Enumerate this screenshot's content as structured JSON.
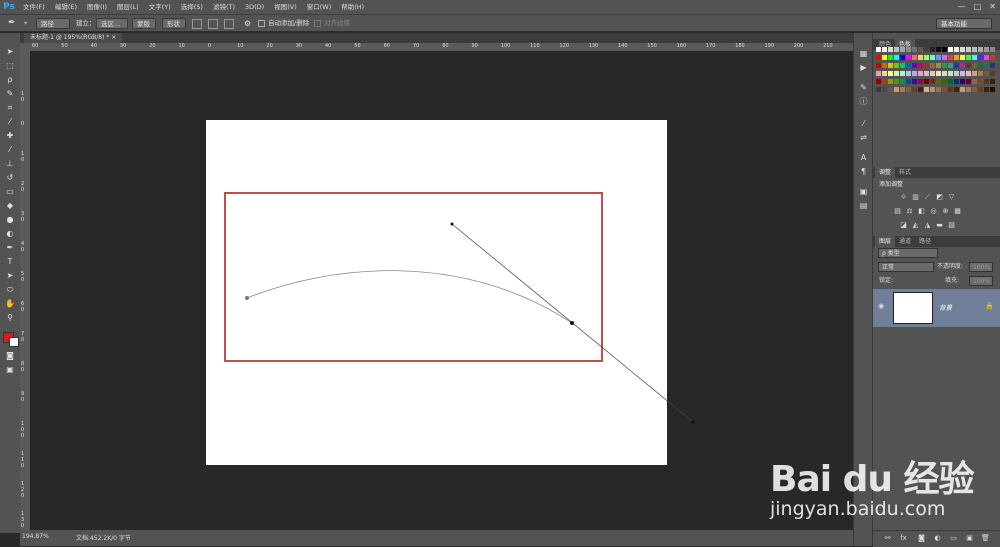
{
  "app": {
    "logo": "Ps"
  },
  "menubar": {
    "items": [
      "文件(F)",
      "编辑(E)",
      "图像(I)",
      "图层(L)",
      "文字(Y)",
      "选择(S)",
      "滤镜(T)",
      "3D(D)",
      "视图(V)",
      "窗口(W)",
      "帮助(H)"
    ]
  },
  "window_controls": {
    "minimize": "—",
    "maximize": "□",
    "close": "✕"
  },
  "options": {
    "tool_mode": "路径",
    "make_label": "建立：",
    "selection_button": "选区...",
    "mask_button": "蒙版",
    "shape_button": "形状",
    "auto_add_delete": "自动添加/删除",
    "align_edges": "对齐边缘",
    "workspace": "基本功能"
  },
  "document": {
    "tab_title": "未标题-1 @ 195%(RGB/8) *",
    "tab_close": "×",
    "zoom": "194.87%",
    "info": "文档:452.2K/0 字节"
  },
  "rulers": {
    "h_labels": [
      "60",
      "50",
      "40",
      "30",
      "20",
      "10",
      "0",
      "10",
      "20",
      "30",
      "40",
      "50",
      "60",
      "70",
      "80",
      "90",
      "100",
      "110",
      "120",
      "130",
      "140",
      "150",
      "160",
      "170",
      "180",
      "190",
      "200",
      "210"
    ],
    "v_labels": [
      "10",
      "0",
      "10",
      "20",
      "30",
      "40",
      "50",
      "60",
      "70",
      "80",
      "90",
      "100",
      "110",
      "120",
      "130"
    ]
  },
  "panels": {
    "swatches_tabs": [
      "颜色",
      "色板"
    ],
    "adjustments_tabs": [
      "调整",
      "样式"
    ],
    "adjustments_title": "添加调整",
    "layers_tabs": [
      "图层",
      "通道",
      "路径"
    ],
    "layer_filter": "ρ 类型",
    "blend_mode": "正常",
    "opacity_label": "不透明度:",
    "opacity_value": "100%",
    "lock_label": "锁定:",
    "fill_label": "填充:",
    "fill_value": "100%",
    "layer_name": "背景"
  },
  "colors": {
    "foreground": "#e8141b",
    "background": "#ffffff",
    "selection_rect": "#c0504d",
    "layer_selected": "#6f7f99"
  },
  "watermark": {
    "logo": "Bai du 经验",
    "url": "jingyan.baidu.com"
  }
}
